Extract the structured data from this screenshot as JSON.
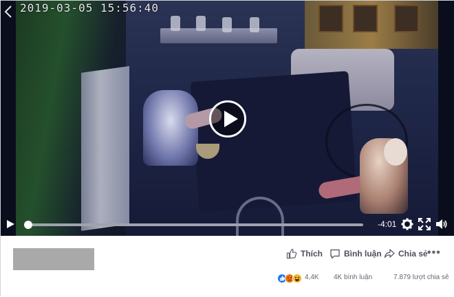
{
  "video": {
    "timestamp": "2019-03-05 15:56:40",
    "time_remaining": "-4:01",
    "progress_fraction": 0.01
  },
  "actions": {
    "like_label": "Thích",
    "comment_label": "Bình luận",
    "share_label": "Chia sẻ",
    "more_label": "•••"
  },
  "stats": {
    "reaction_count": "4,4K",
    "comments_text": "4K bình luận",
    "shares_text": "7.879 lượt chia sẻ",
    "reaction_types": [
      "like-icon",
      "angry-icon",
      "haha-icon"
    ]
  },
  "colors": {
    "like_blue": "#1877f2",
    "angry_orange": "#e9710f",
    "haha_yellow": "#f7b125",
    "action_text": "#4b4f56",
    "meta_text": "#606770",
    "placeholder_gray": "#a9a9a9"
  }
}
